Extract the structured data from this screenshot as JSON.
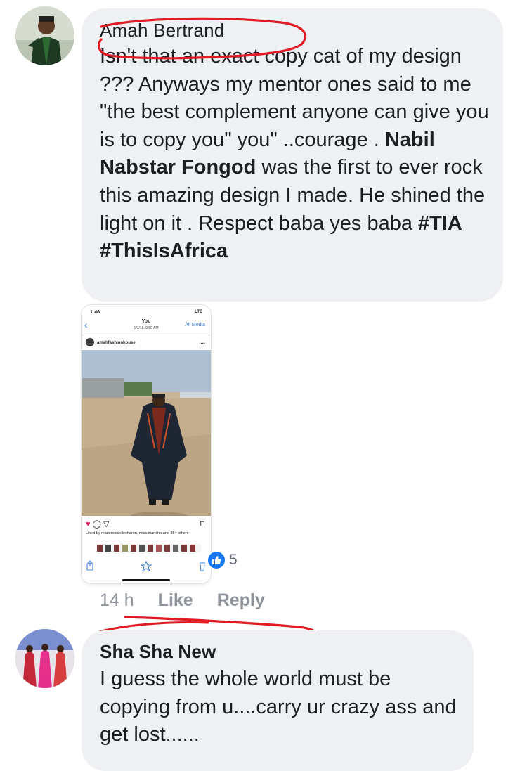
{
  "comments": [
    {
      "author": "Amah Bertrand",
      "text_parts": [
        "Isn't that an exact copy cat of my design ??? Anyways my mentor ones said to me \"the best complement anyone can give you is to copy you\" you\"   ..courage . ",
        "Nabil Nabstar Fongod",
        " was the first to ever rock this amazing design I made. He shined the light on it . Respect baba yes baba ",
        "#TIA #ThisIsAfrica"
      ],
      "timestamp": "14 h",
      "like_label": "Like",
      "reply_label": "Reply",
      "reaction_count": "5",
      "reaction_icon": "thumbs-up-icon",
      "reaction_color": "#1877f2",
      "attachment": {
        "status_time": "1:46",
        "status_network": "LTE",
        "title": "You",
        "subtitle": "1/7/18, 9:50 AM",
        "back_icon": "chevron-left-icon",
        "all_media_label": "All Media",
        "post_username": "amahfashionhouse",
        "more_label": "...",
        "likes_text": "Liked by mademoisellesharon, miss.mancho and 354 others"
      }
    },
    {
      "author": "Sha Sha New",
      "text": "I guess the whole world must be copying from u....carry ur crazy ass and get lost......"
    }
  ],
  "colors": {
    "bubble": "#eef0f3",
    "meta_text": "#90949c",
    "scribble": "#e01b24",
    "link": "#3b7bd6"
  }
}
